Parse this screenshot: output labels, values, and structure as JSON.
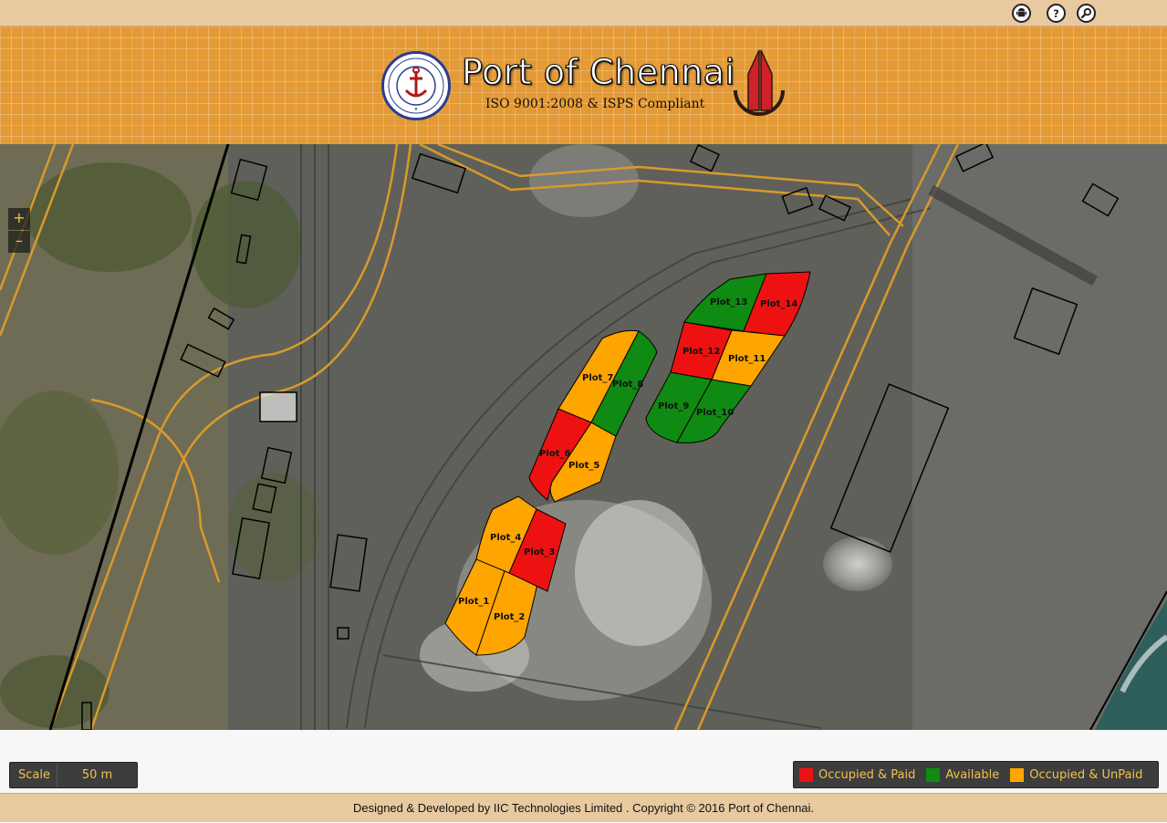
{
  "topbar": {
    "icons": [
      "android-icon",
      "help-icon",
      "search-icon"
    ]
  },
  "header": {
    "title": "Port of Chennai",
    "subtitle": "ISO 9001:2008 & ISPS Compliant"
  },
  "map": {
    "zoom_in_label": "+",
    "zoom_out_label": "–",
    "plots": [
      {
        "label": "Plot_1",
        "status": "occupied-unpaid"
      },
      {
        "label": "Plot_2",
        "status": "occupied-unpaid"
      },
      {
        "label": "Plot_3",
        "status": "occupied-paid"
      },
      {
        "label": "Plot_4",
        "status": "occupied-unpaid"
      },
      {
        "label": "Plot_5",
        "status": "occupied-unpaid"
      },
      {
        "label": "Plot_6",
        "status": "occupied-paid"
      },
      {
        "label": "Plot_7",
        "status": "occupied-unpaid"
      },
      {
        "label": "Plot_8",
        "status": "available"
      },
      {
        "label": "Plot_9",
        "status": "available"
      },
      {
        "label": "Plot_10",
        "status": "available"
      },
      {
        "label": "Plot_11",
        "status": "occupied-unpaid"
      },
      {
        "label": "Plot_12",
        "status": "occupied-paid"
      },
      {
        "label": "Plot_13",
        "status": "available"
      },
      {
        "label": "Plot_14",
        "status": "occupied-paid"
      }
    ]
  },
  "scale": {
    "label": "Scale",
    "value": "50 m"
  },
  "legend": {
    "items": [
      {
        "label": "Occupied & Paid",
        "color": "#ee1111"
      },
      {
        "label": "Available",
        "color": "#0f8a12"
      },
      {
        "label": "Occupied & UnPaid",
        "color": "#ffa500"
      }
    ]
  },
  "colors": {
    "occupied-paid": "#ee1111",
    "available": "#0f8a12",
    "occupied-unpaid": "#ffa500"
  },
  "footer": {
    "text": "Designed & Developed by IIC Technologies Limited . Copyright © 2016 Port of Chennai."
  }
}
